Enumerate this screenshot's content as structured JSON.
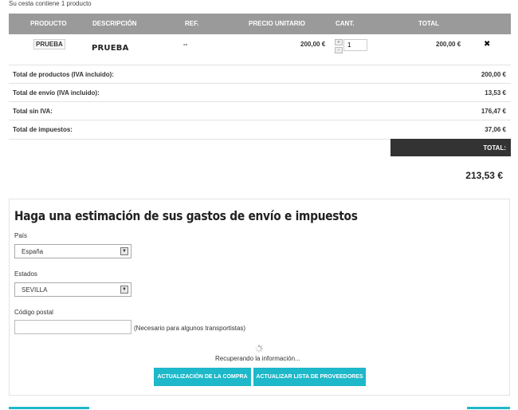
{
  "cart": {
    "summary": "Su cesta contiene 1 producto",
    "columns": {
      "product": "PRODUCTO",
      "description": "DESCRIPCIÓN",
      "ref": "REF.",
      "unit_price": "PRECIO UNITARIO",
      "qty": "CANT.",
      "total": "TOTAL"
    },
    "item": {
      "thumb": "PRUEBA",
      "name": "PRUEBA",
      "ref": "--",
      "unit_price": "200,00 €",
      "qty": "1",
      "total": "200,00 €",
      "qty_up_icon": "plus-icon",
      "qty_down_icon": "minus-icon",
      "remove_icon": "close-icon"
    },
    "totals": [
      {
        "label": "Total de productos (IVA incluido):",
        "value": "200,00 €"
      },
      {
        "label": "Total de envío (IVA incluido):",
        "value": "13,53 €"
      },
      {
        "label": "Total sin IVA:",
        "value": "176,47 €"
      },
      {
        "label": "Total de impuestos:",
        "value": "37,06 €"
      }
    ],
    "total_label": "TOTAL:",
    "grand_total": "213,53 €"
  },
  "estimate": {
    "title": "Haga una estimación de sus gastos de envío e impuestos",
    "country_label": "País",
    "country_value": "España",
    "state_label": "Estados",
    "state_value": "SEVILLA",
    "zip_label": "Código postal",
    "zip_value": "",
    "zip_note": "(Necesario para algunos transportistas)",
    "loading": "Recuperando la información...",
    "update_button": "ACTUALIZACIÓN DE LA COMPRA",
    "carriers_button": "ACTUALIZAR LISTA DE PROVEEDORES"
  },
  "colors": {
    "header_bg": "#9a9a9a",
    "total_bar_bg": "#333333",
    "accent": "#1db8c9"
  }
}
